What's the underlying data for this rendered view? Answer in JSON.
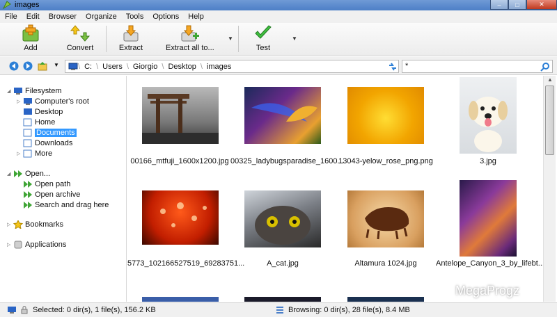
{
  "window": {
    "title": "images"
  },
  "window_buttons": [
    "–",
    "□",
    "✕"
  ],
  "menu": [
    "File",
    "Edit",
    "Browser",
    "Organize",
    "Tools",
    "Options",
    "Help"
  ],
  "toolbar": {
    "add": "Add",
    "convert": "Convert",
    "extract": "Extract",
    "extract_all": "Extract all to...",
    "test": "Test"
  },
  "address": {
    "path": [
      "C:",
      "Users",
      "Giorgio",
      "Desktop",
      "images"
    ],
    "separator": "\\",
    "search_value": "*"
  },
  "sidebar": {
    "filesystem": {
      "label": "Filesystem",
      "items": [
        "Computer's root",
        "Desktop",
        "Home",
        "Documents",
        "Downloads",
        "More"
      ],
      "selected": "Documents"
    },
    "open": {
      "label": "Open...",
      "items": [
        "Open path",
        "Open archive",
        "Search and drag here"
      ]
    },
    "bookmarks": "Bookmarks",
    "applications": "Applications"
  },
  "files": [
    {
      "name": "00166_mtfuji_1600x1200.jpg"
    },
    {
      "name": "00325_ladybugsparadise_1600..."
    },
    {
      "name": "13043-yelow_rose_png.png"
    },
    {
      "name": "3.jpg"
    },
    {
      "name": "5773_102166527519_69283751..."
    },
    {
      "name": "A_cat.jpg"
    },
    {
      "name": "Altamura 1024.jpg"
    },
    {
      "name": "Antelope_Canyon_3_by_lifebt..."
    }
  ],
  "status": {
    "left": "Selected: 0 dir(s), 1 file(s), 156.2 KB",
    "right": "Browsing: 0 dir(s), 28 file(s), 8.4 MB"
  },
  "watermark": "MegaProgz",
  "colors": {
    "selection": "#3399ff",
    "titlebar": "#5a87cc"
  }
}
